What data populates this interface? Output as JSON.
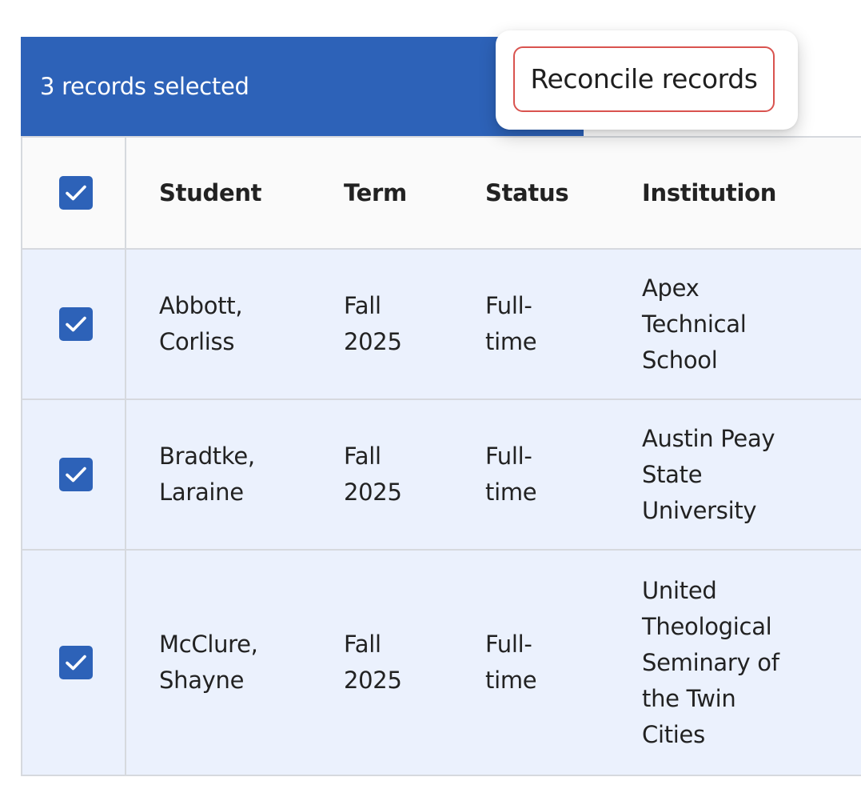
{
  "bulk_bar": {
    "count_label": "3 records selected",
    "background": "#2d62b8"
  },
  "popover": {
    "reconcile_label": "Reconcile records",
    "highlight_color": "#d9534f"
  },
  "table": {
    "columns": {
      "select_all_checked": true,
      "student": "Student",
      "term": "Term",
      "status": "Status",
      "institution": "Institution"
    },
    "rows": [
      {
        "checked": true,
        "student": "Abbott,\nCorliss",
        "term": "Fall\n2025",
        "status": "Full-\ntime",
        "institution": "Apex\nTechnical\nSchool"
      },
      {
        "checked": true,
        "student": "Bradtke,\nLaraine",
        "term": "Fall\n2025",
        "status": "Full-\ntime",
        "institution": "Austin Peay\nState\nUniversity"
      },
      {
        "checked": true,
        "student": "McClure,\nShayne",
        "term": "Fall\n2025",
        "status": "Full-\ntime",
        "institution": "United\nTheological\nSeminary of\nthe Twin\nCities"
      }
    ]
  },
  "colors": {
    "accent": "#2d62b8",
    "selected_row_bg": "#ebf1fd",
    "link": "#2f47a8",
    "border": "#d6d9de"
  },
  "icons": {
    "checkbox": "checkmark-icon"
  }
}
